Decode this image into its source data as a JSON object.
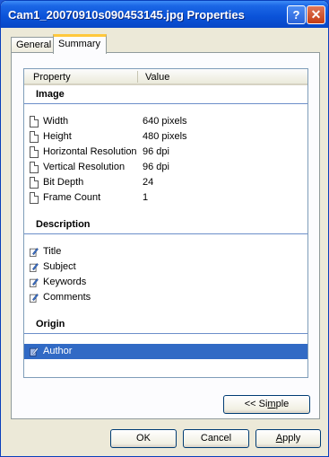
{
  "window": {
    "title": "Cam1_20070910s090453145.jpg Properties",
    "help_label": "?",
    "close_label": "✕"
  },
  "tabs": [
    {
      "label": "General"
    },
    {
      "label": "Summary"
    }
  ],
  "list": {
    "columns": [
      "Property",
      "Value"
    ],
    "groups": {
      "image": "Image",
      "description": "Description",
      "origin": "Origin"
    },
    "image_rows": [
      {
        "label": "Width",
        "value": "640 pixels"
      },
      {
        "label": "Height",
        "value": "480 pixels"
      },
      {
        "label": "Horizontal Resolution",
        "value": "96 dpi"
      },
      {
        "label": "Vertical Resolution",
        "value": "96 dpi"
      },
      {
        "label": "Bit Depth",
        "value": "24"
      },
      {
        "label": "Frame Count",
        "value": "1"
      }
    ],
    "description_rows": [
      {
        "label": "Title"
      },
      {
        "label": "Subject"
      },
      {
        "label": "Keywords"
      },
      {
        "label": "Comments"
      }
    ],
    "origin_rows": [
      {
        "label": "Author",
        "selected": true
      }
    ]
  },
  "buttons": {
    "simple_prefix": "<< Si",
    "simple_hotkey": "m",
    "simple_suffix": "ple",
    "ok": "OK",
    "cancel": "Cancel",
    "apply_hotkey": "A",
    "apply_suffix": "pply"
  },
  "icons": {
    "readonly_property": "document-icon",
    "editable_property": "edit-pencil-icon"
  },
  "colors": {
    "selection": "#316ac5",
    "group_rule": "#6c8ec9",
    "tab_accent": "#ffc83c"
  }
}
